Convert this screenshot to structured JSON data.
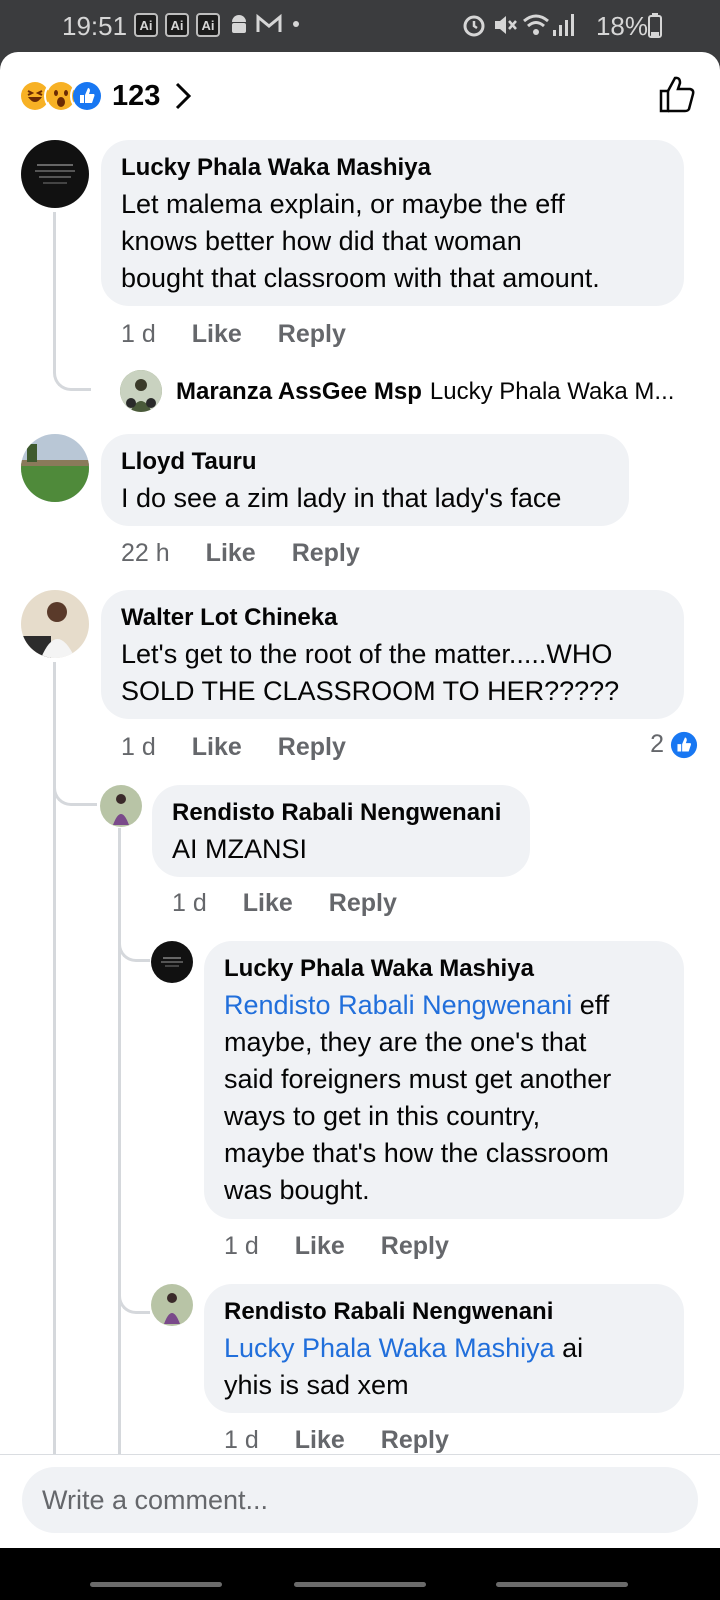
{
  "status_bar": {
    "time": "19:51",
    "app_badges": [
      "Ai",
      "Ai",
      "Ai"
    ],
    "battery": "18%",
    "icons": [
      "ai-app-icon",
      "ai-app-icon",
      "ai-app-icon",
      "android-robot-icon",
      "gmail-icon",
      "dot-icon",
      "alarm-icon",
      "mute-icon",
      "wifi-icon",
      "signal-icon",
      "battery-icon"
    ]
  },
  "reactions": {
    "count": "123",
    "emojis": [
      "laugh-emoji",
      "wow-emoji",
      "like-emoji"
    ]
  },
  "comments": [
    {
      "name": "Lucky Phala Waka Mashiya",
      "lines": [
        "Let malema explain, or maybe the eff",
        "knows better how did that woman",
        "bought that classroom with that amount."
      ],
      "time": "1 d",
      "like": "Like",
      "reply": "Reply",
      "reply_preview": {
        "name": "Maranza AssGee Msp",
        "text": "Lucky Phala Waka M..."
      }
    },
    {
      "name": "Lloyd Tauru",
      "lines": [
        "I do see a zim lady in that lady's face"
      ],
      "time": "22 h",
      "like": "Like",
      "reply": "Reply"
    },
    {
      "name": "Walter Lot Chineka",
      "lines": [
        "Let's get to the root of the matter.....WHO",
        "SOLD THE CLASSROOM TO HER?????"
      ],
      "time": "1 d",
      "like": "Like",
      "reply": "Reply",
      "like_count": "2"
    }
  ],
  "replies": [
    {
      "name": "Rendisto Rabali Nengwenani",
      "lines": [
        "AI MZANSI"
      ],
      "time": "1 d",
      "like": "Like",
      "reply": "Reply"
    },
    {
      "name": "Lucky Phala Waka Mashiya",
      "mention": "Rendisto Rabali Nengwenani",
      "first_line_rest": " eff",
      "lines": [
        "maybe, they are the one's that",
        "said foreigners must get another",
        "ways to get in this country,",
        "maybe that's how the classroom",
        "was bought."
      ],
      "time": "1 d",
      "like": "Like",
      "reply": "Reply"
    },
    {
      "name": "Rendisto Rabali Nengwenani",
      "mention": "Lucky Phala Waka Mashiya",
      "first_line_rest": " ai",
      "lines": [
        "yhis is sad xem"
      ],
      "time": "1 d",
      "like": "Like",
      "reply": "Reply"
    }
  ],
  "composer": {
    "placeholder": "Write a comment..."
  },
  "colors": {
    "bubble": "#f0f2f5",
    "mention": "#216fdb",
    "like_blue": "#1877f2",
    "meta_gray": "#65676b"
  }
}
